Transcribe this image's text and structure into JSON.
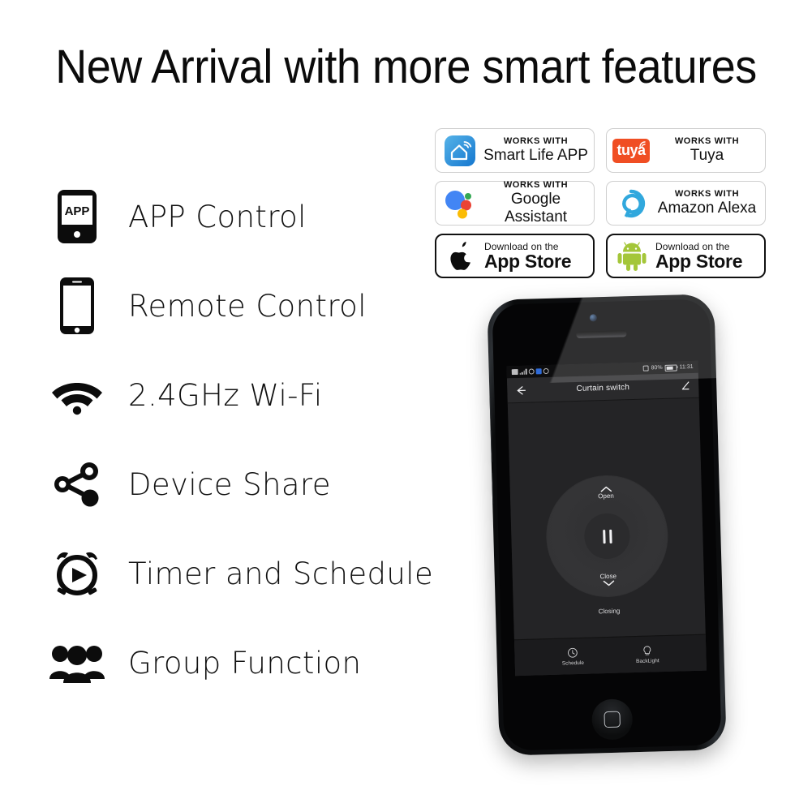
{
  "headline": "New Arrival with more smart features",
  "features": [
    {
      "icon": "app-phone-icon",
      "label": "APP Control"
    },
    {
      "icon": "smartphone-icon",
      "label": "Remote Control"
    },
    {
      "icon": "wifi-icon",
      "label": "2.4GHz Wi-Fi"
    },
    {
      "icon": "share-nodes-icon",
      "label": "Device Share"
    },
    {
      "icon": "alarm-clock-icon",
      "label": "Timer and Schedule"
    },
    {
      "icon": "group-people-icon",
      "label": "Group Function"
    }
  ],
  "badges": [
    {
      "id": "smart-life-app",
      "style": "works",
      "logo": "smart-life-house-wifi-icon",
      "top": "WORKS WITH",
      "main": "Smart Life APP",
      "color": "#2196dd"
    },
    {
      "id": "tuya",
      "style": "works",
      "logo": "tuya-logo-icon",
      "logo_text": "tuya",
      "top": "WORKS WITH",
      "main": "Tuya",
      "color": "#f04e23"
    },
    {
      "id": "google-assistant",
      "style": "works",
      "logo": "google-assistant-dots-icon",
      "top": "WORKS WITH",
      "main": "Google Assistant",
      "color": "#4285f4"
    },
    {
      "id": "amazon-alexa",
      "style": "works",
      "logo": "amazon-alexa-ring-icon",
      "top": "WORKS WITH",
      "main": "Amazon Alexa",
      "color": "#31a8dd"
    },
    {
      "id": "apple-app-store",
      "style": "store",
      "logo": "apple-icon",
      "top": "Download on the",
      "main": "App Store",
      "color": "#111111"
    },
    {
      "id": "android-app-store",
      "style": "store",
      "logo": "android-robot-icon",
      "top": "Download on the",
      "main": "App Store",
      "color": "#a4c639"
    }
  ],
  "phone": {
    "status_bar": {
      "battery": "80%",
      "time": "11:31"
    },
    "app": {
      "title": "Curtain switch",
      "back_icon": "arrow-left-icon",
      "edit_icon": "pencil-edit-icon",
      "control": {
        "open_label": "Open",
        "close_label": "Close",
        "center_action": "pause",
        "status": "Closing"
      },
      "tabs": [
        {
          "icon": "clock-icon",
          "label": "Schedule"
        },
        {
          "icon": "bulb-icon",
          "label": "BackLight"
        }
      ]
    }
  }
}
